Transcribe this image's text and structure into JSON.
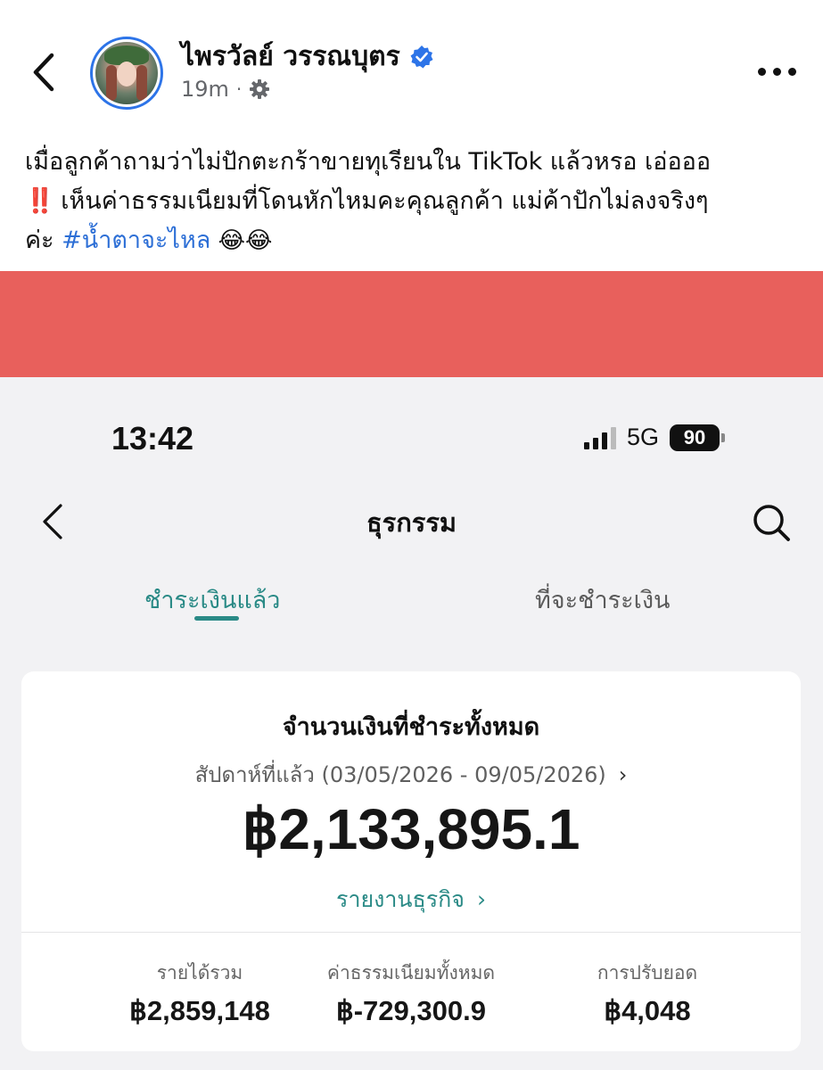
{
  "post": {
    "author_name": "ไพรวัลย์ วรรณบุตร",
    "time_ago": "19m",
    "separator": "·",
    "text_line1": "เมื่อลูกค้าถามว่าไม่ปักตะกร้าขายทุเรียนใน TikTok แล้วหรอ  เอ่อออ",
    "text_line2_bang": "‼️",
    "text_line2": " เห็นค่าธรรมเนียมที่โดนหักไหมคะคุณลูกค้า  แม่ค้าปักไม่ลงจริงๆ",
    "text_line3_prefix": "ค่ะ ",
    "hashtag": "#น้ำตาจะไหล",
    "emojis": " 😂😂",
    "icons": {
      "back": "chevron-left-icon",
      "verified": "verified-badge-icon",
      "privacy": "gear-icon",
      "more": "more-dots-icon"
    }
  },
  "banner": {
    "color": "#e8605c"
  },
  "phone": {
    "status": {
      "time": "13:42",
      "network": "5G",
      "battery": "90"
    },
    "header": {
      "title": "ธุรกรรม"
    },
    "tabs": [
      {
        "label": "ชำระเงินแล้ว",
        "active": true
      },
      {
        "label": "ที่จะชำระเงิน",
        "active": false
      }
    ],
    "summary": {
      "title": "จำนวนเงินที่ชำระทั้งหมด",
      "period": "สัปดาห์ที่แล้ว (03/05/2026 - 09/05/2026)",
      "period_chevron": "›",
      "amount": "฿2,133,895.1",
      "link": "รายงานธุรกิจ",
      "link_chevron": "›",
      "stats": [
        {
          "label": "รายได้รวม",
          "value": "฿2,859,148"
        },
        {
          "label": "ค่าธรรมเนียมทั้งหมด",
          "value": "฿-729,300.9"
        },
        {
          "label": "การปรับยอด",
          "value": "฿4,048"
        }
      ]
    },
    "accent_color": "#2a8a86"
  }
}
